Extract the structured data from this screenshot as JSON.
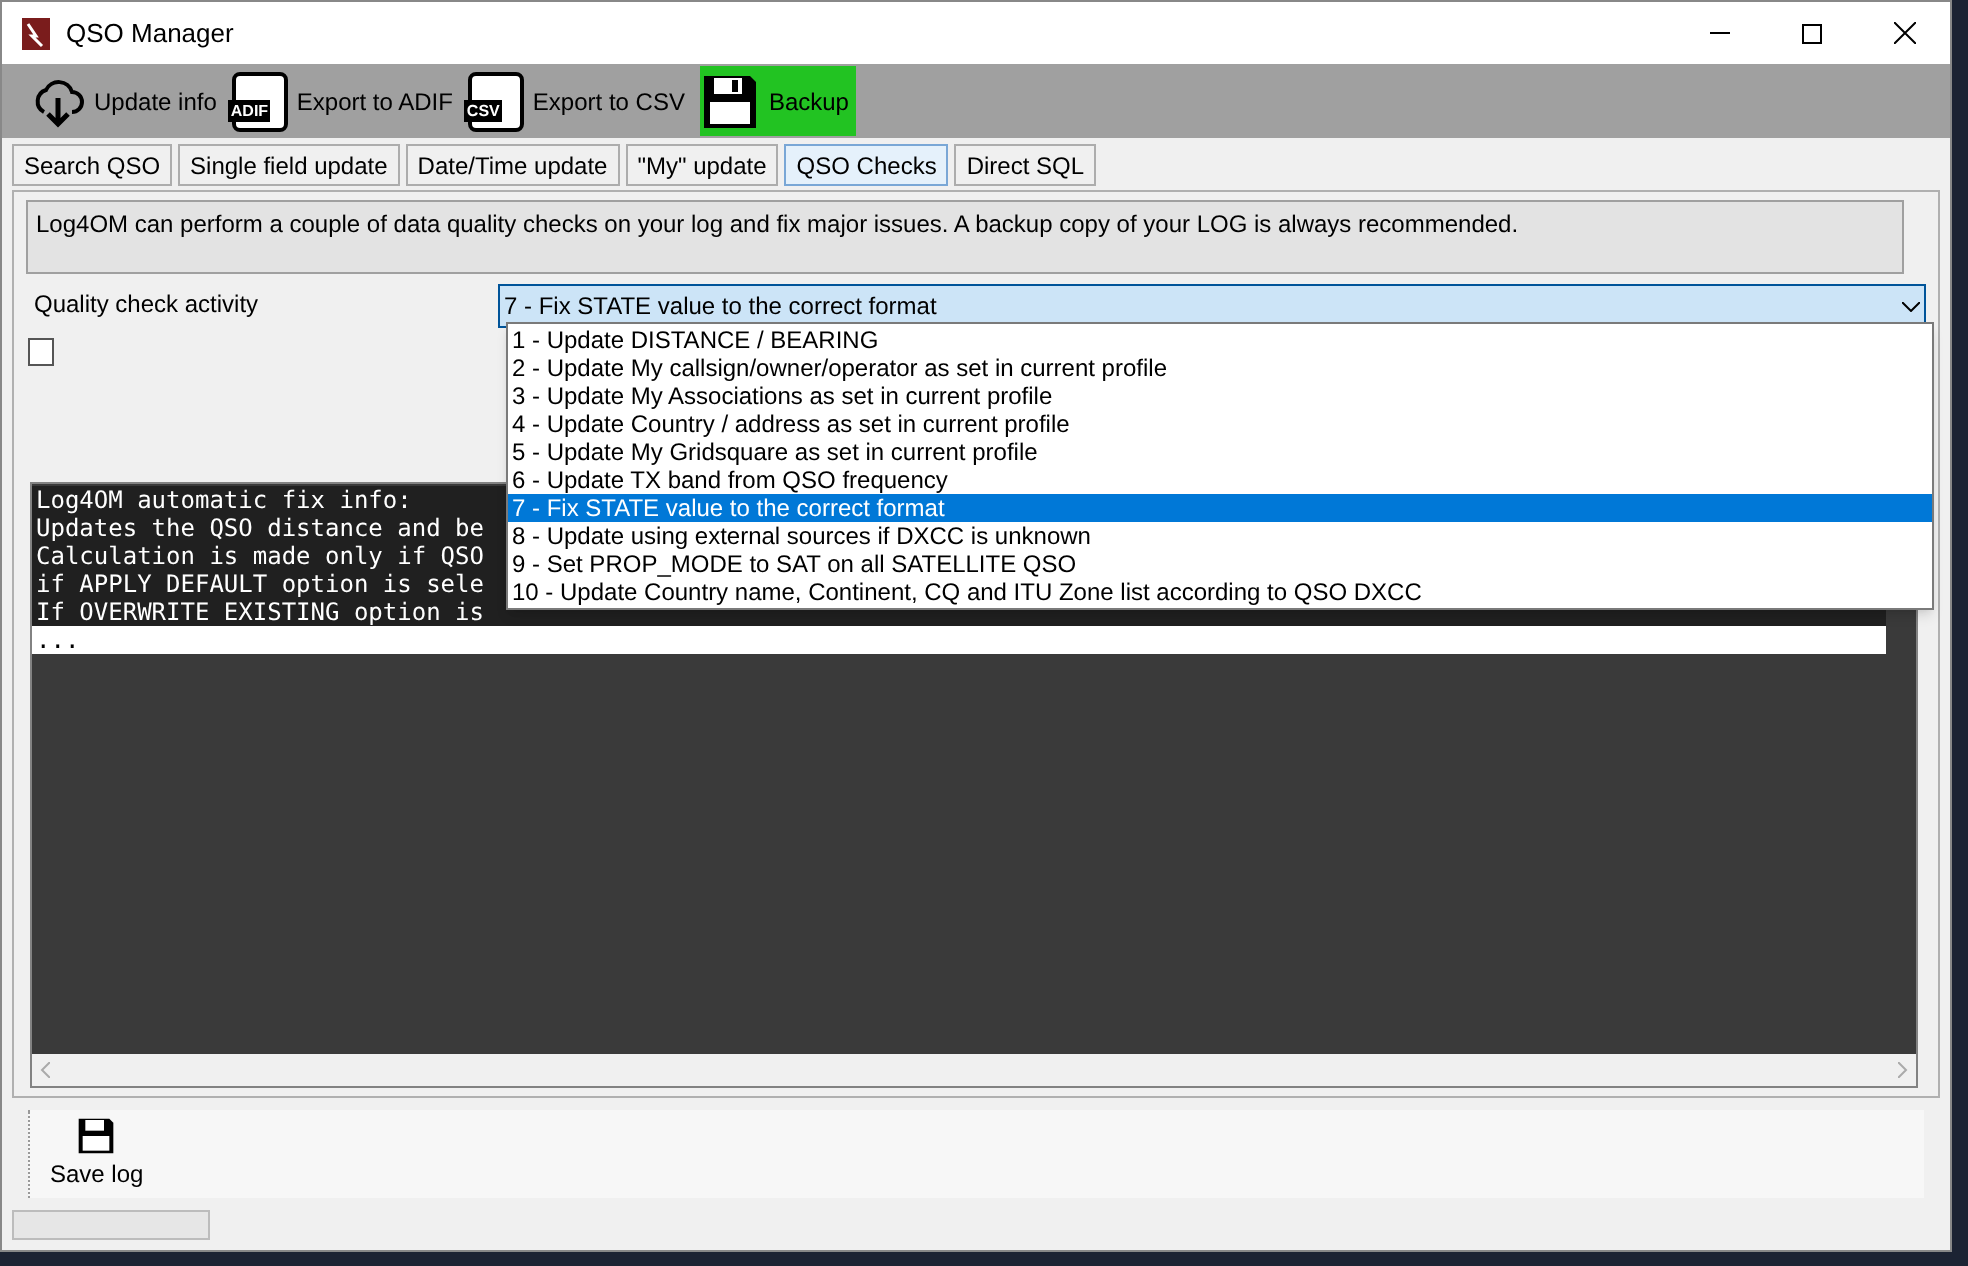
{
  "window": {
    "title": "QSO Manager"
  },
  "toolbar": [
    {
      "label": "Update info",
      "kind": "download",
      "selected": false
    },
    {
      "label": "Export to ADIF",
      "kind": "adif",
      "selected": false,
      "badge": "ADIF"
    },
    {
      "label": "Export to CSV",
      "kind": "csv",
      "selected": false,
      "badge": "CSV"
    },
    {
      "label": "Backup",
      "kind": "save",
      "selected": true
    }
  ],
  "tabs": [
    {
      "label": "Search QSO",
      "selected": false
    },
    {
      "label": "Single field update",
      "selected": false
    },
    {
      "label": "Date/Time update",
      "selected": false
    },
    {
      "label": "\"My\" update",
      "selected": false
    },
    {
      "label": "QSO Checks",
      "selected": true
    },
    {
      "label": "Direct SQL",
      "selected": false
    }
  ],
  "info": "Log4OM can perform a couple of data quality checks on your log and fix major issues. A backup copy of your LOG is always recommended.",
  "activity": {
    "label": "Quality check activity",
    "value": "7 - Fix STATE value to the correct format",
    "expanded": true,
    "options": [
      {
        "label": "1 - Update DISTANCE / BEARING",
        "selected": false
      },
      {
        "label": "2 - Update My callsign/owner/operator as set in current profile",
        "selected": false
      },
      {
        "label": "3 - Update My Associations as set in current profile",
        "selected": false
      },
      {
        "label": "4 - Update Country / address as set in current profile",
        "selected": false
      },
      {
        "label": "5 - Update My Gridsquare as set in current profile",
        "selected": false
      },
      {
        "label": "6 - Update TX band from QSO frequency",
        "selected": false
      },
      {
        "label": "7 - Fix STATE value to the correct format",
        "selected": true
      },
      {
        "label": "8 - Update using external sources if DXCC is unknown",
        "selected": false
      },
      {
        "label": "9 - Set PROP_MODE to SAT on all SATELLITE QSO",
        "selected": false
      },
      {
        "label": "10 - Update Country name, Continent, CQ and ITU Zone list according to QSO DXCC",
        "selected": false
      }
    ]
  },
  "option_checkbox": {
    "checked": false
  },
  "log": {
    "highlighted_lines": [
      "Log4OM automatic fix info:",
      "Updates the QSO distance and be",
      "Calculation is made only if QSO",
      "if APPLY DEFAULT option is sele",
      "If OVERWRITE EXISTING option is"
    ],
    "lines": [
      "..."
    ]
  },
  "bottom_toolbar": [
    {
      "label": "Save log"
    }
  ],
  "status_bar": {
    "progress": {
      "level": 0
    }
  }
}
